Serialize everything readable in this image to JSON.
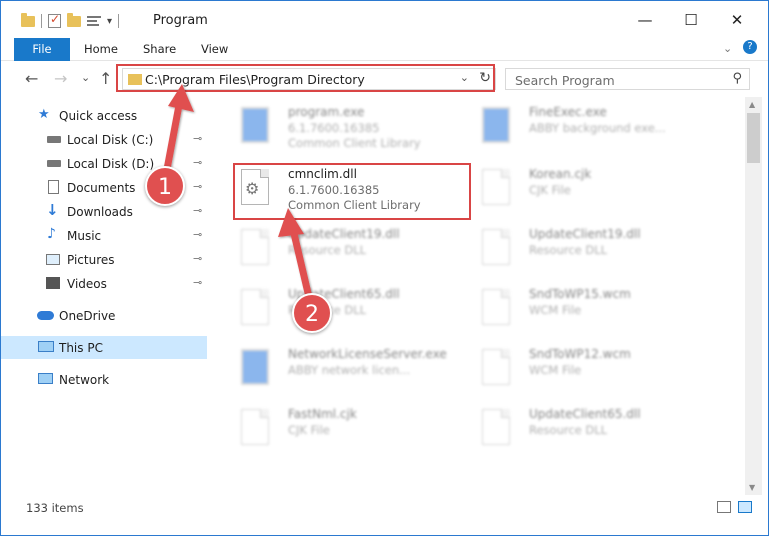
{
  "window": {
    "title": "Program",
    "minimize_glyph": "—",
    "maximize_glyph": "☐",
    "close_glyph": "✕"
  },
  "ribbon": {
    "tabs": [
      "File",
      "Home",
      "Share",
      "View"
    ],
    "collapse_glyph": "⌄",
    "help_glyph": "?"
  },
  "navigation": {
    "back_glyph": "←",
    "forward_glyph": "→",
    "recent_glyph": "⌄",
    "up_glyph": "↑",
    "address": "C:\\Program Files\\Program Directory",
    "address_dropdown_glyph": "⌄",
    "refresh_glyph": "↻",
    "search_placeholder": "Search Program",
    "search_glyph": "⚲"
  },
  "sidebar": {
    "items": [
      {
        "label": "Quick access",
        "icon": "star-icon",
        "pinned": false
      },
      {
        "label": "Local Disk (C:)",
        "icon": "drive-icon",
        "pinned": true
      },
      {
        "label": "Local Disk (D:)",
        "icon": "drive-icon",
        "pinned": true
      },
      {
        "label": "Documents",
        "icon": "documents-icon",
        "pinned": true
      },
      {
        "label": "Downloads",
        "icon": "downloads-icon",
        "pinned": true
      },
      {
        "label": "Music",
        "icon": "music-icon",
        "pinned": true
      },
      {
        "label": "Pictures",
        "icon": "pictures-icon",
        "pinned": true
      },
      {
        "label": "Videos",
        "icon": "videos-icon",
        "pinned": true
      },
      {
        "label": "OneDrive",
        "icon": "onedrive-icon",
        "pinned": false
      },
      {
        "label": "This PC",
        "icon": "this-pc-icon",
        "pinned": false,
        "selected": true
      },
      {
        "label": "Network",
        "icon": "network-icon",
        "pinned": false
      }
    ],
    "pin_glyph": "📌"
  },
  "files": [
    {
      "name": "program.exe",
      "line2": "6.1.7600.16385",
      "line3": "Common Client Library",
      "icon": "exe-icon",
      "highlighted": false
    },
    {
      "name": "FineExec.exe",
      "line2": "ABBY background exe...",
      "line3": "",
      "icon": "exe-icon",
      "highlighted": false
    },
    {
      "name": "cmnclim.dll",
      "line2": "6.1.7600.16385",
      "line3": "Common Client Library",
      "icon": "dll-gear-icon",
      "highlighted": true
    },
    {
      "name": "Korean.cjk",
      "line2": "CJK File",
      "line3": "",
      "icon": "file-icon",
      "highlighted": false
    },
    {
      "name": "UpdateClient19.dll",
      "line2": "Resource DLL",
      "line3": "",
      "icon": "dll-gear-icon",
      "highlighted": false
    },
    {
      "name": "UpdateClient19.dll",
      "line2": "Resource DLL",
      "line3": "",
      "icon": "dll-gear-icon",
      "highlighted": false
    },
    {
      "name": "UpdateClient65.dll",
      "line2": "Resource DLL",
      "line3": "",
      "icon": "dll-gear-icon",
      "highlighted": false
    },
    {
      "name": "SndToWP15.wcm",
      "line2": "WCM File",
      "line3": "",
      "icon": "file-icon",
      "highlighted": false
    },
    {
      "name": "NetworkLicenseServer.exe",
      "line2": "ABBY network licen...",
      "line3": "",
      "icon": "exe-icon",
      "highlighted": false
    },
    {
      "name": "SndToWP12.wcm",
      "line2": "WCM File",
      "line3": "",
      "icon": "file-icon",
      "highlighted": false
    },
    {
      "name": "FastNml.cjk",
      "line2": "CJK File",
      "line3": "",
      "icon": "file-icon",
      "highlighted": false
    },
    {
      "name": "UpdateClient65.dll",
      "line2": "Resource DLL",
      "line3": "",
      "icon": "dll-gear-icon",
      "highlighted": false
    }
  ],
  "status": {
    "item_count": "133 items"
  },
  "annotations": {
    "badge_1": "1",
    "badge_2": "2",
    "highlight_color": "#d94545"
  },
  "colors": {
    "accent": "#1979ca",
    "selected_bg": "#cce8ff",
    "folder": "#e8c15a"
  }
}
